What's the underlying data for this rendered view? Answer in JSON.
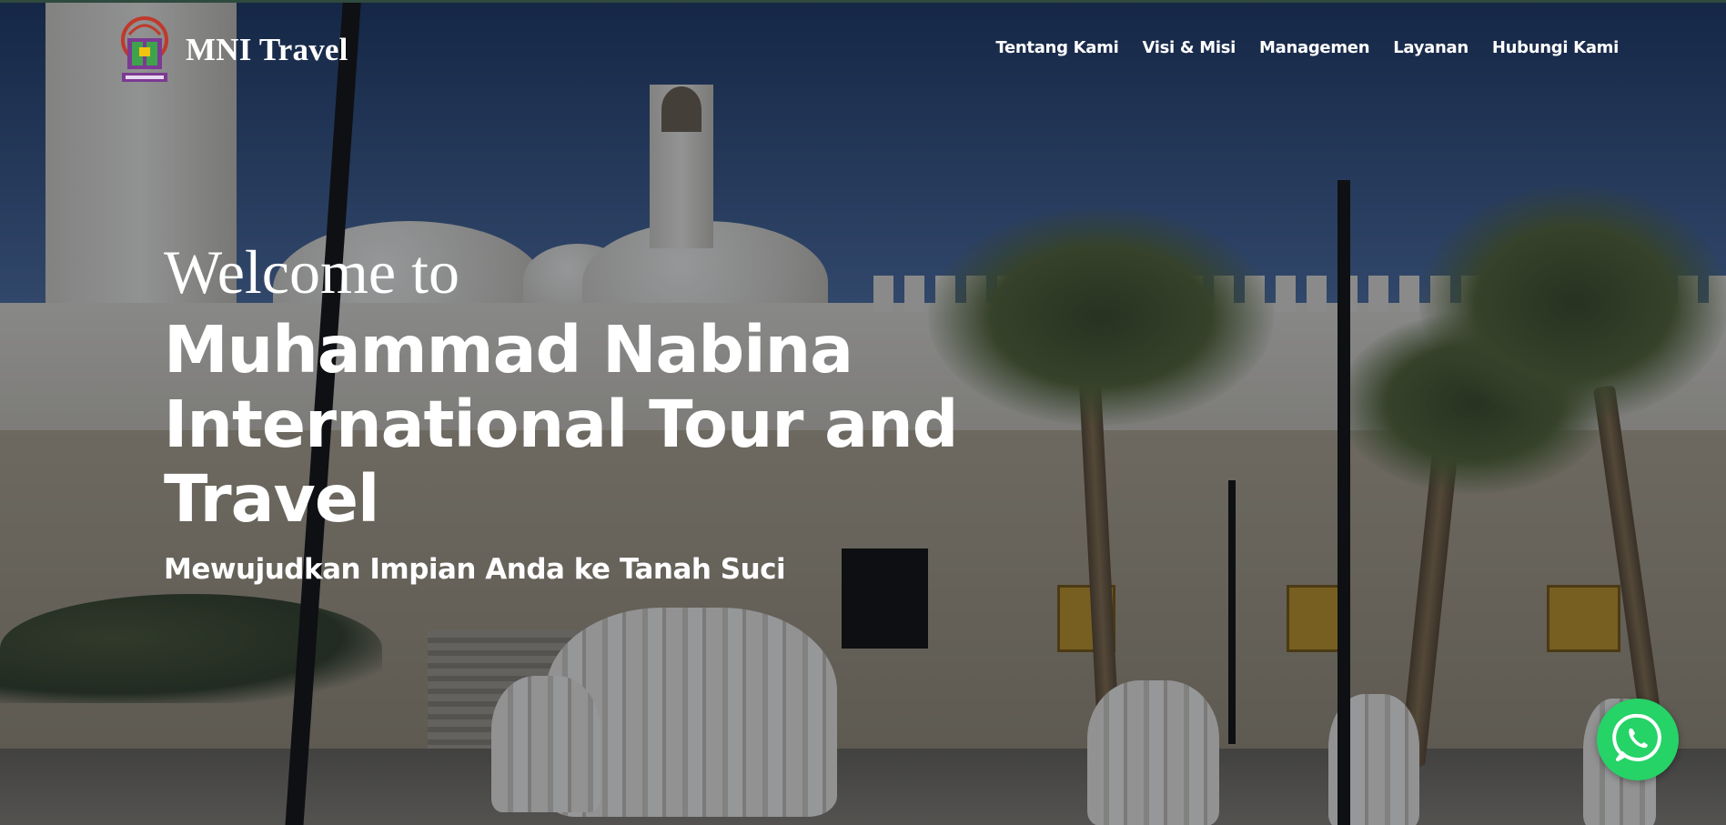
{
  "header": {
    "brand_name": "MNI Travel",
    "logo_icon": "mni-tour-travel-logo",
    "nav": [
      {
        "label": "Tentang Kami"
      },
      {
        "label": "Visi & Misi"
      },
      {
        "label": "Managemen"
      },
      {
        "label": "Layanan"
      },
      {
        "label": "Hubungi Kami"
      }
    ]
  },
  "hero": {
    "welcome": "Welcome to",
    "company": "Muhammad Nabina International Tour and Travel",
    "tagline": "Mewujudkan Impian Anda ke Tanah Suci",
    "background": "mosque-courtyard-photo"
  },
  "whatsapp": {
    "icon": "whatsapp-icon",
    "color": "#25d366"
  }
}
